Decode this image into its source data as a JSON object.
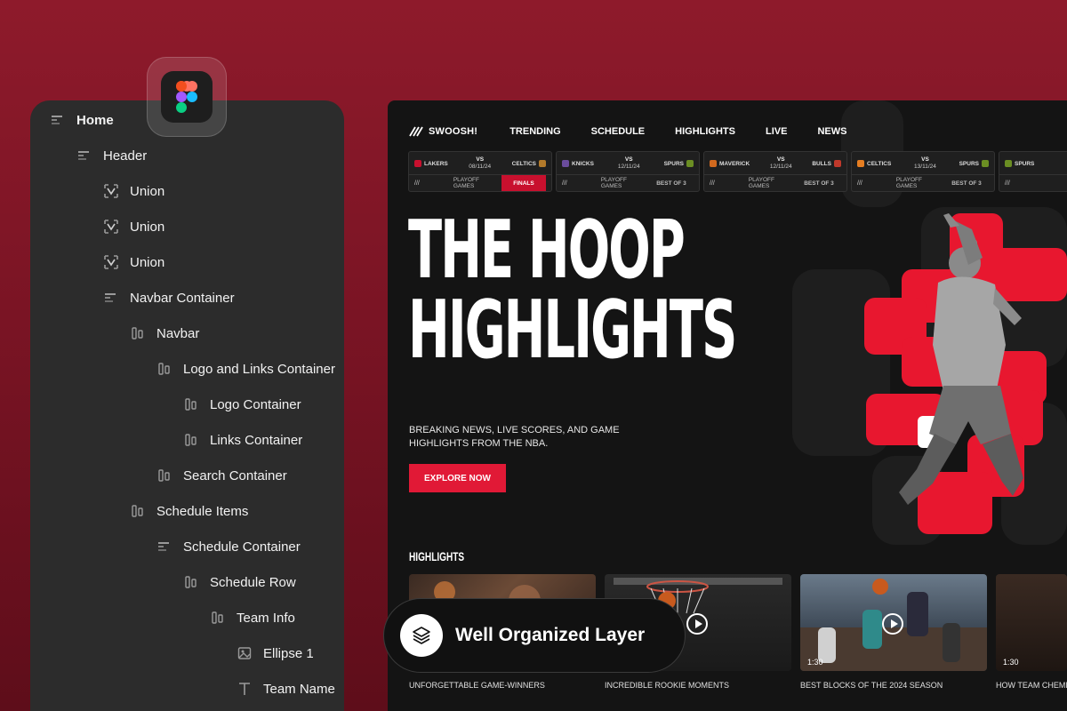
{
  "layers": [
    {
      "label": "Home",
      "icon": "frame-icon",
      "level": 0,
      "bold": true
    },
    {
      "label": "Header",
      "icon": "frame-icon",
      "level": 1
    },
    {
      "label": "Union",
      "icon": "union-icon",
      "level": 2
    },
    {
      "label": "Union",
      "icon": "union-icon",
      "level": 2
    },
    {
      "label": "Union",
      "icon": "union-icon",
      "level": 2
    },
    {
      "label": "Navbar Container",
      "icon": "frame-icon",
      "level": 2
    },
    {
      "label": "Navbar",
      "icon": "auto-layout-icon",
      "level": 3
    },
    {
      "label": "Logo and Links Container",
      "icon": "auto-layout-icon",
      "level": 4
    },
    {
      "label": "Logo Container",
      "icon": "auto-layout-icon",
      "level": 5
    },
    {
      "label": "Links Container",
      "icon": "auto-layout-icon",
      "level": 5
    },
    {
      "label": "Search Container",
      "icon": "auto-layout-icon",
      "level": 4
    },
    {
      "label": "Schedule Items",
      "icon": "auto-layout-icon",
      "level": 3
    },
    {
      "label": "Schedule Container",
      "icon": "frame-icon",
      "level": 4
    },
    {
      "label": "Schedule Row",
      "icon": "auto-layout-icon",
      "level": 5
    },
    {
      "label": "Team Info",
      "icon": "auto-layout-icon",
      "level": 6
    },
    {
      "label": "Ellipse 1",
      "icon": "image-icon",
      "level": 7
    },
    {
      "label": "Team Name",
      "icon": "text-icon",
      "level": 7
    }
  ],
  "site": {
    "logo": "SWOOSH!",
    "nav": [
      "TRENDING",
      "SCHEDULE",
      "HIGHLIGHTS",
      "LIVE",
      "NEWS"
    ],
    "schedule": [
      {
        "home": "LAKERS",
        "away": "CELTICS",
        "date": "08/11/24",
        "type": "PLAYOFF GAMES",
        "status": "FINALS",
        "home_color": "#c8102e",
        "away_color": "#b37a2a"
      },
      {
        "home": "KNICKS",
        "away": "SPURS",
        "date": "12/11/24",
        "type": "PLAYOFF GAMES",
        "status": "BEST OF 3",
        "home_color": "#6a4c9c",
        "away_color": "#6b8e23"
      },
      {
        "home": "MAVERICK",
        "away": "BULLS",
        "date": "12/11/24",
        "type": "PLAYOFF GAMES",
        "status": "BEST OF 3",
        "home_color": "#d2691e",
        "away_color": "#c0392b"
      },
      {
        "home": "CELTICS",
        "away": "SPURS",
        "date": "13/11/24",
        "type": "PLAYOFF GAMES",
        "status": "BEST OF 3",
        "home_color": "#e67e22",
        "away_color": "#6b8e23"
      },
      {
        "home": "SPURS",
        "away": "",
        "date": "",
        "type": "",
        "status": "",
        "home_color": "#6b8e23",
        "away_color": "#444444"
      }
    ],
    "vs_label": "VS",
    "hero": {
      "line1": "THE HOOP",
      "line2": "HIGHLIGHTS",
      "subtitle": "BREAKING NEWS, LIVE SCORES, AND GAME HIGHLIGHTS FROM THE NBA.",
      "cta": "EXPLORE NOW"
    },
    "highlights_heading": "HIGHLIGHTS",
    "highlights": [
      {
        "caption": "UNFORGETTABLE GAME-WINNERS",
        "duration": ""
      },
      {
        "caption": "INCREDIBLE ROOKIE MOMENTS",
        "duration": ""
      },
      {
        "caption": "BEST BLOCKS OF THE 2024 SEASON",
        "duration": "1:30"
      },
      {
        "caption": "HOW TEAM CHEMIS",
        "duration": "1:30"
      }
    ]
  },
  "pill": {
    "label": "Well Organized Layer",
    "icon": "layers-icon"
  },
  "colors": {
    "accent": "#e8172f",
    "panel": "#2c2c2c",
    "site_bg": "#141414"
  }
}
